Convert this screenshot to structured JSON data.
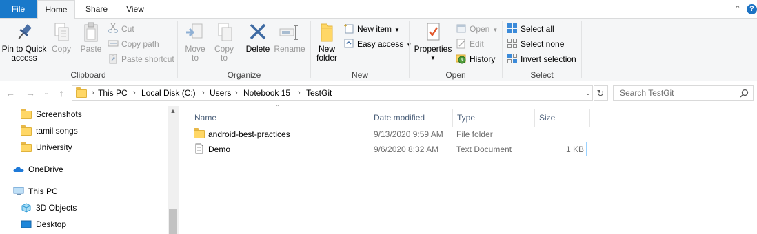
{
  "tabs": {
    "file": "File",
    "home": "Home",
    "share": "Share",
    "view": "View"
  },
  "ribbon": {
    "clipboard": {
      "label": "Clipboard",
      "pin_to_quick_access": [
        "Pin to Quick",
        "access"
      ],
      "copy": "Copy",
      "paste": "Paste",
      "cut": "Cut",
      "copy_path": "Copy path",
      "paste_shortcut": "Paste shortcut"
    },
    "organize": {
      "label": "Organize",
      "move_to": [
        "Move",
        "to"
      ],
      "copy_to": [
        "Copy",
        "to"
      ],
      "delete": "Delete",
      "rename": "Rename"
    },
    "new": {
      "label": "New",
      "new_folder": [
        "New",
        "folder"
      ],
      "new_item": "New item",
      "easy_access": "Easy access"
    },
    "open": {
      "label": "Open",
      "properties": "Properties",
      "open": "Open",
      "edit": "Edit",
      "history": "History"
    },
    "select": {
      "label": "Select",
      "select_all": "Select all",
      "select_none": "Select none",
      "invert_selection": "Invert selection"
    }
  },
  "address": {
    "crumbs": [
      "This PC",
      "Local Disk (C:)",
      "Users",
      "Notebook 15",
      "TestGit"
    ],
    "search_placeholder": "Search TestGit"
  },
  "nav_pane": {
    "items": [
      {
        "label": "Screenshots",
        "icon": "folder-icon"
      },
      {
        "label": "tamil songs",
        "icon": "folder-icon"
      },
      {
        "label": "University",
        "icon": "folder-icon"
      },
      {
        "label": "OneDrive",
        "icon": "onedrive-cloud-icon"
      },
      {
        "label": "This PC",
        "icon": "computer-icon"
      },
      {
        "label": "3D Objects",
        "icon": "3d-objects-icon"
      },
      {
        "label": "Desktop",
        "icon": "desktop-icon"
      }
    ]
  },
  "file_list": {
    "columns": [
      "Name",
      "Date modified",
      "Type",
      "Size"
    ],
    "rows": [
      {
        "name": "android-best-practices",
        "date": "9/13/2020 9:59 AM",
        "type": "File folder",
        "size": "",
        "icon": "folder-icon"
      },
      {
        "name": "Demo",
        "date": "9/6/2020 8:32 AM",
        "type": "Text Document",
        "size": "1 KB",
        "icon": "text-document-icon"
      }
    ]
  },
  "colors": {
    "accent": "#1979ca",
    "folder": "#ffd766",
    "ribbon_bg": "#f5f6f7",
    "disabled_text": "#9a9a9a",
    "selection_border": "#99d1ff"
  }
}
